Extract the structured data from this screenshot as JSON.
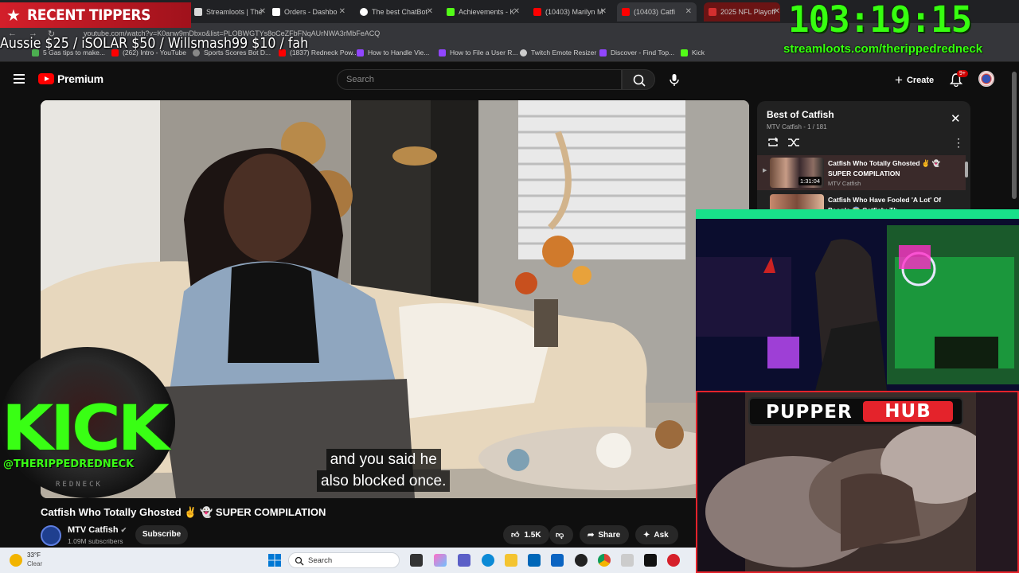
{
  "browser": {
    "tabs": [
      {
        "label": "Streamloots | The",
        "color": "#d8d8d8"
      },
      {
        "label": "Orders - Dashbo",
        "color": "#ffffff"
      },
      {
        "label": "The best ChatBot",
        "color": "#ffffff"
      },
      {
        "label": "Achievements - K",
        "color": "#53fc18"
      },
      {
        "label": "(10403) Marilyn M",
        "color": "#ff0000"
      },
      {
        "label": "(10403) Catfi",
        "color": "#ff0000"
      },
      {
        "label": "2025 NFL Playoff",
        "color": "#d32f2f"
      }
    ],
    "url": "youtube.com/watch?v=K0anw9mDbxo&list=PLOBWGTYs8oCeZFbFNqAUrNWA3rMbFeACQ",
    "bookmarks": [
      "5 Gas tips to make...",
      "(262) Intro - YouTube",
      "Sports Scores Bot D...",
      "(1837) Redneck Pow...",
      "How to Handle Vie...",
      "How to File a User R...",
      "Twitch Emote Resizer",
      "Discover - Find Top...",
      "Kick"
    ]
  },
  "overlay": {
    "tippers_label": "RECENT TIPPERS",
    "tippers_list": "Aussie $25 / iSOLAR $50 / Willsmash99 $10 / fah",
    "timer": "103:19:15",
    "streamloots_url": "streamloots.com/therippedredneck",
    "kick_logo": "KICK",
    "kick_handle": "@THERIPPEDREDNECK",
    "kick_sub": "REDNECK",
    "pupper_left": "PUPPER",
    "pupper_right": "HUB"
  },
  "youtube": {
    "brand": "Premium",
    "search_placeholder": "Search",
    "create_label": "Create",
    "notif_count": "9+",
    "caption_line1": "and you said he",
    "caption_line2": "also blocked once.",
    "title": "Catfish Who Totally Ghosted ✌️ 👻 SUPER COMPILATION",
    "channel": "MTV Catfish",
    "subscribers": "1.09M subscribers",
    "subscribe_label": "Subscribe",
    "likes": "1.5K",
    "share_label": "Share",
    "ask_label": "Ask"
  },
  "playlist": {
    "title": "Best of Catfish",
    "subtitle": "MTV Catfish - 1 / 181",
    "items": [
      {
        "title": "Catfish Who Totally Ghosted ✌️ 👻 SUPER COMPILATION",
        "channel": "MTV Catfish",
        "duration": "1:31:04"
      },
      {
        "title": "Catfish Who Have Fooled 'A Lot' Of People 😱 Catfish: Th",
        "channel": "",
        "duration": ""
      }
    ]
  },
  "taskbar": {
    "temperature": "33°F",
    "condition": "Clear",
    "search_label": "Search"
  }
}
